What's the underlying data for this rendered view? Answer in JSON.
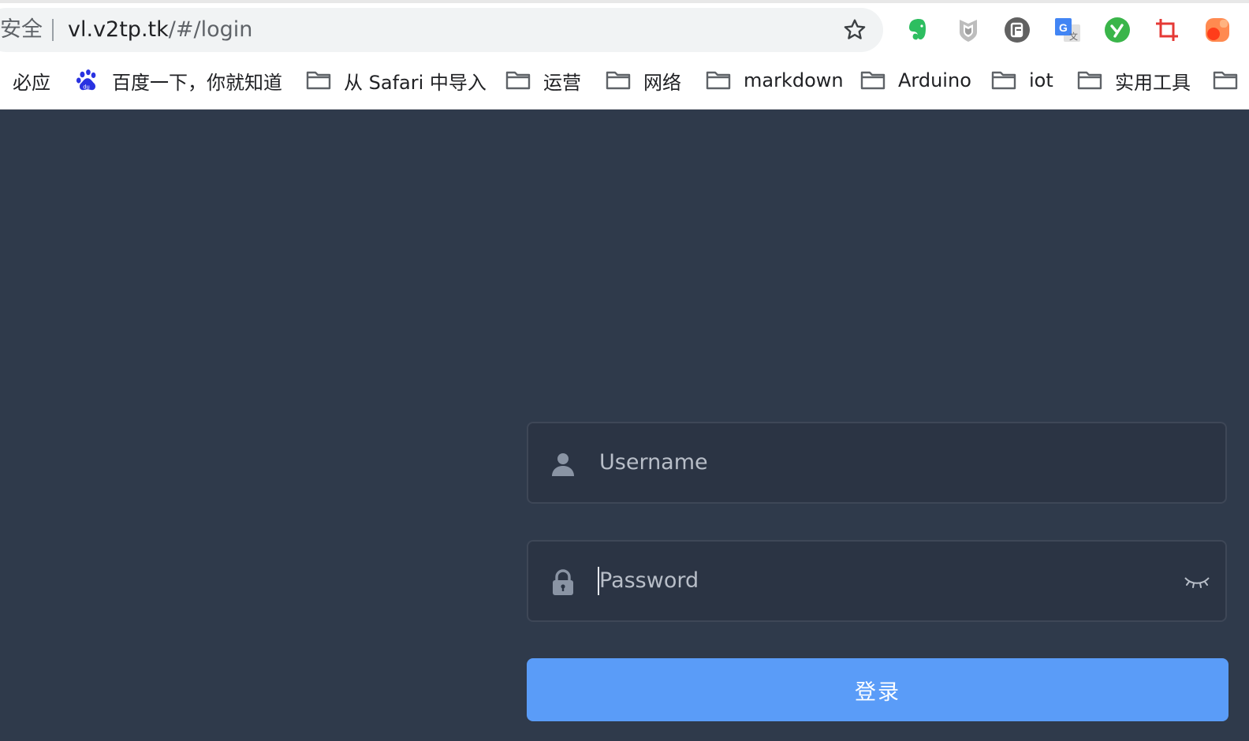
{
  "browser": {
    "security_label": "安全",
    "url_host": "vl.v2tp.tk",
    "url_path": "/#/login",
    "bookmark_star_icon": "star-outline-icon",
    "extensions": [
      {
        "name": "evernote",
        "icon": "evernote-elephant-icon",
        "color": "#2dbe60"
      },
      {
        "name": "shield",
        "icon": "shield-icon",
        "color": "#9aa0a6"
      },
      {
        "name": "pocket-save",
        "icon": "clipboard-circle-icon",
        "color": "#5f6368"
      },
      {
        "name": "google-translate",
        "icon": "translate-icon",
        "color": "#4285f4"
      },
      {
        "name": "yoyo",
        "icon": "y-circle-icon",
        "color": "#2dbe60"
      },
      {
        "name": "crop",
        "icon": "crop-icon",
        "color": "#e53935"
      },
      {
        "name": "orange-extension",
        "icon": "orange-blob-icon",
        "color": "#ff7043"
      }
    ]
  },
  "bookmarks": [
    {
      "label": "必应",
      "icon": "none"
    },
    {
      "label": "百度一下，你就知道",
      "icon": "baidu-paw-icon"
    },
    {
      "label": "从 Safari 中导入",
      "icon": "folder-icon"
    },
    {
      "label": "运营",
      "icon": "folder-icon"
    },
    {
      "label": "网络",
      "icon": "folder-icon"
    },
    {
      "label": "markdown",
      "icon": "folder-icon"
    },
    {
      "label": "Arduino",
      "icon": "folder-icon"
    },
    {
      "label": "iot",
      "icon": "folder-icon"
    },
    {
      "label": "实用工具",
      "icon": "folder-icon"
    }
  ],
  "login": {
    "username_placeholder": "Username",
    "password_placeholder": "Password",
    "submit_label": "登录",
    "user_icon": "user-icon",
    "lock_icon": "lock-icon",
    "eye_icon": "eye-closed-icon"
  },
  "colors": {
    "page_background": "#2f3a4b",
    "input_background": "#2b3444",
    "button_primary": "#5a9cf8"
  }
}
